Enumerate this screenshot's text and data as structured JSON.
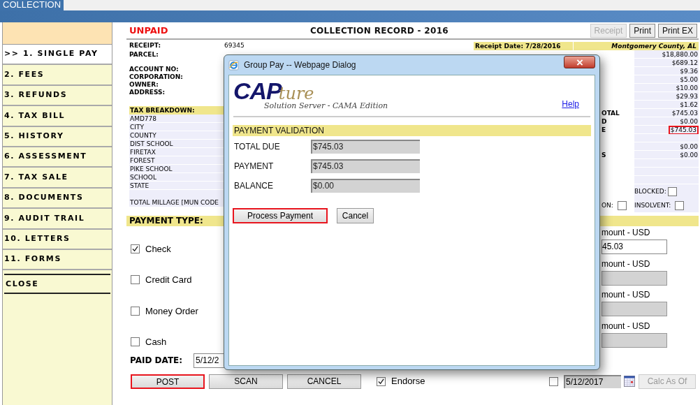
{
  "app_tab": "COLLECTION",
  "sidebar": {
    "items": [
      {
        "label": ">> 1. SINGLE PAY",
        "selected": true,
        "kind": "nav"
      },
      {
        "label": "2. FEES",
        "selected": false,
        "kind": "nav"
      },
      {
        "label": "3. REFUNDS",
        "selected": false,
        "kind": "nav"
      },
      {
        "label": "4. TAX BILL",
        "selected": false,
        "kind": "nav"
      },
      {
        "label": "5. HISTORY",
        "selected": false,
        "kind": "nav"
      },
      {
        "label": "6. ASSESSMENT",
        "selected": false,
        "kind": "nav"
      },
      {
        "label": "7. TAX SALE",
        "selected": false,
        "kind": "nav"
      },
      {
        "label": "8. DOCUMENTS",
        "selected": false,
        "kind": "nav"
      },
      {
        "label": "9. AUDIT TRAIL",
        "selected": false,
        "kind": "nav"
      },
      {
        "label": "10. LETTERS",
        "selected": false,
        "kind": "nav"
      },
      {
        "label": "11. FORMS",
        "selected": false,
        "kind": "nav"
      },
      {
        "label": "CLOSE",
        "selected": false,
        "kind": "close"
      }
    ]
  },
  "status": "UNPAID",
  "title": "COLLECTION RECORD - 2016",
  "toolbar": [
    {
      "label": "Receipt",
      "disabled": true
    },
    {
      "label": "Print",
      "disabled": false
    },
    {
      "label": "Print EX",
      "disabled": false
    }
  ],
  "record": {
    "receipt_label": "RECEIPT:",
    "receipt_value": "69345",
    "receipt_date": "Receipt Date: 7/28/2016",
    "county": "Montgomery County, AL"
  },
  "owner_fields": [
    "PARCEL:",
    "ACCOUNT NO:",
    "CORPORATION:",
    "OWNER:",
    "ADDRESS:"
  ],
  "tax_breakdown": {
    "title": "TAX BREAKDOWN:",
    "items": [
      "AMD778",
      "CITY",
      "COUNTY",
      "DIST SCHOOL",
      "FIRETAX",
      "FOREST",
      "PIKE SCHOOL",
      "SCHOOL",
      "STATE"
    ],
    "total_millage": "TOTAL MILLAGE [MUN CODE"
  },
  "amounts": [
    {
      "kind": "amount",
      "value": "$18,880.00"
    },
    {
      "kind": "amount",
      "value": "$689.12"
    },
    {
      "kind": "amount",
      "value": "$9.36"
    },
    {
      "kind": "amount",
      "value": "$5.00"
    },
    {
      "kind": "amount",
      "value": "$10.00"
    },
    {
      "kind": "amount",
      "value": "$29.93"
    },
    {
      "kind": "amount",
      "value": "$1.62"
    },
    {
      "kind": "amount",
      "label": "OTAL",
      "value": "$745.03"
    },
    {
      "kind": "amount",
      "label": "D",
      "value": "$0.00"
    },
    {
      "kind": "amount",
      "label": "E",
      "value": "$745.03",
      "highlighted": true
    },
    {
      "kind": "blank"
    },
    {
      "kind": "amount",
      "value": "$0.00"
    },
    {
      "kind": "amount",
      "label": "S",
      "value": "$0.00"
    },
    {
      "kind": "blank"
    },
    {
      "kind": "blank"
    },
    {
      "kind": "blank"
    }
  ],
  "blocked": {
    "label": "BLOCKED:",
    "checked": false
  },
  "flags": [
    {
      "label": "ON:",
      "checked": false
    },
    {
      "label": "INSOLVENT:",
      "checked": false
    }
  ],
  "payment_type": {
    "title": "PAYMENT TYPE:",
    "methods": [
      {
        "label": "Check",
        "checked": true,
        "amount_label": "mount - USD",
        "amount": "45.03",
        "editable": true
      },
      {
        "label": "Credit Card",
        "checked": false,
        "amount_label": "mount - USD",
        "editable": false
      },
      {
        "label": "Money Order",
        "checked": false,
        "amount_label": "mount - USD",
        "editable": false
      },
      {
        "label": "Cash",
        "checked": false,
        "amount_label": "mount - USD",
        "editable": false
      }
    ]
  },
  "paid_date": {
    "label": "PAID DATE:",
    "value": "5/12/2"
  },
  "actions": [
    {
      "label": "POST",
      "highlighted": true
    },
    {
      "label": "SCAN",
      "highlighted": false
    },
    {
      "label": "CANCEL",
      "highlighted": false
    }
  ],
  "endorse": {
    "label": "Endorse",
    "checked": true
  },
  "calc_as_of": {
    "checked": false,
    "date": "5/12/2017",
    "button": "Calc As Of",
    "disabled": true
  },
  "dialog": {
    "title": "Group Pay -- Webpage Dialog",
    "logo_main": "CAP",
    "logo_script": "ture",
    "logo_tagline": "Solution Server - CAMA Edition",
    "help": "Help",
    "section": "PAYMENT VALIDATION",
    "fields": [
      {
        "label": "TOTAL DUE",
        "value": "$745.03"
      },
      {
        "label": "PAYMENT",
        "value": "$745.03"
      },
      {
        "label": "BALANCE",
        "value": "$0.00"
      }
    ],
    "buttons": [
      {
        "label": "Process Payment",
        "highlighted": true
      },
      {
        "label": "Cancel",
        "highlighted": false
      }
    ]
  }
}
